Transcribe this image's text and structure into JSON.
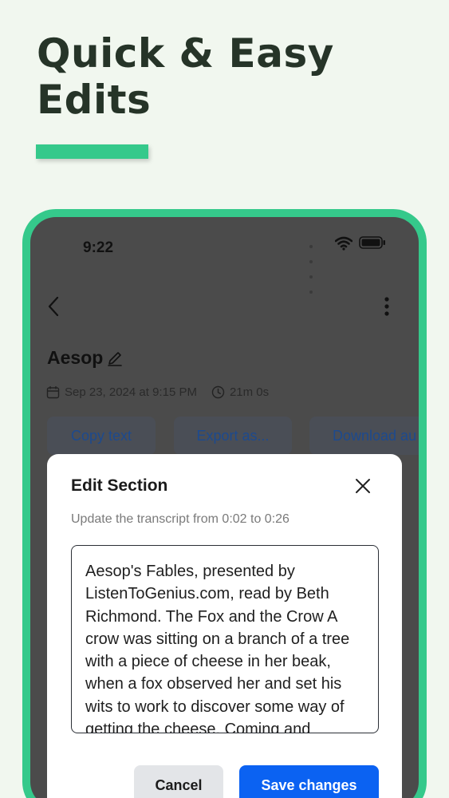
{
  "hero": {
    "line1": "Quick & Easy",
    "line2": "Edits"
  },
  "colors": {
    "accent_green": "#35c98b",
    "headline": "#263428",
    "primary_blue": "#0b62f2",
    "link_blue": "#1d4a8e"
  },
  "status_bar": {
    "time": "9:22",
    "icons": [
      "signal-icon",
      "wifi-icon",
      "battery-icon"
    ]
  },
  "nav": {
    "back_icon": "chevron-left-icon",
    "more_icon": "more-vertical-icon"
  },
  "document": {
    "title": "Aesop",
    "date": "Sep 23, 2024 at 9:15 PM",
    "duration": "21m 0s"
  },
  "actions": [
    {
      "label": "Copy text"
    },
    {
      "label": "Export as..."
    },
    {
      "label": "Download au"
    }
  ],
  "modal": {
    "title": "Edit Section",
    "subtitle": "Update the transcript from 0:02 to 0:26",
    "transcript": "Aesop's Fables, presented by ListenToGenius.com, read by Beth Richmond. The Fox and the Crow A crow was sitting on a branch of a tree with a piece of cheese in her beak, when a fox observed her and set his wits to work to discover some way of getting the cheese. Coming and",
    "cancel_label": "Cancel",
    "save_label": "Save changes"
  }
}
